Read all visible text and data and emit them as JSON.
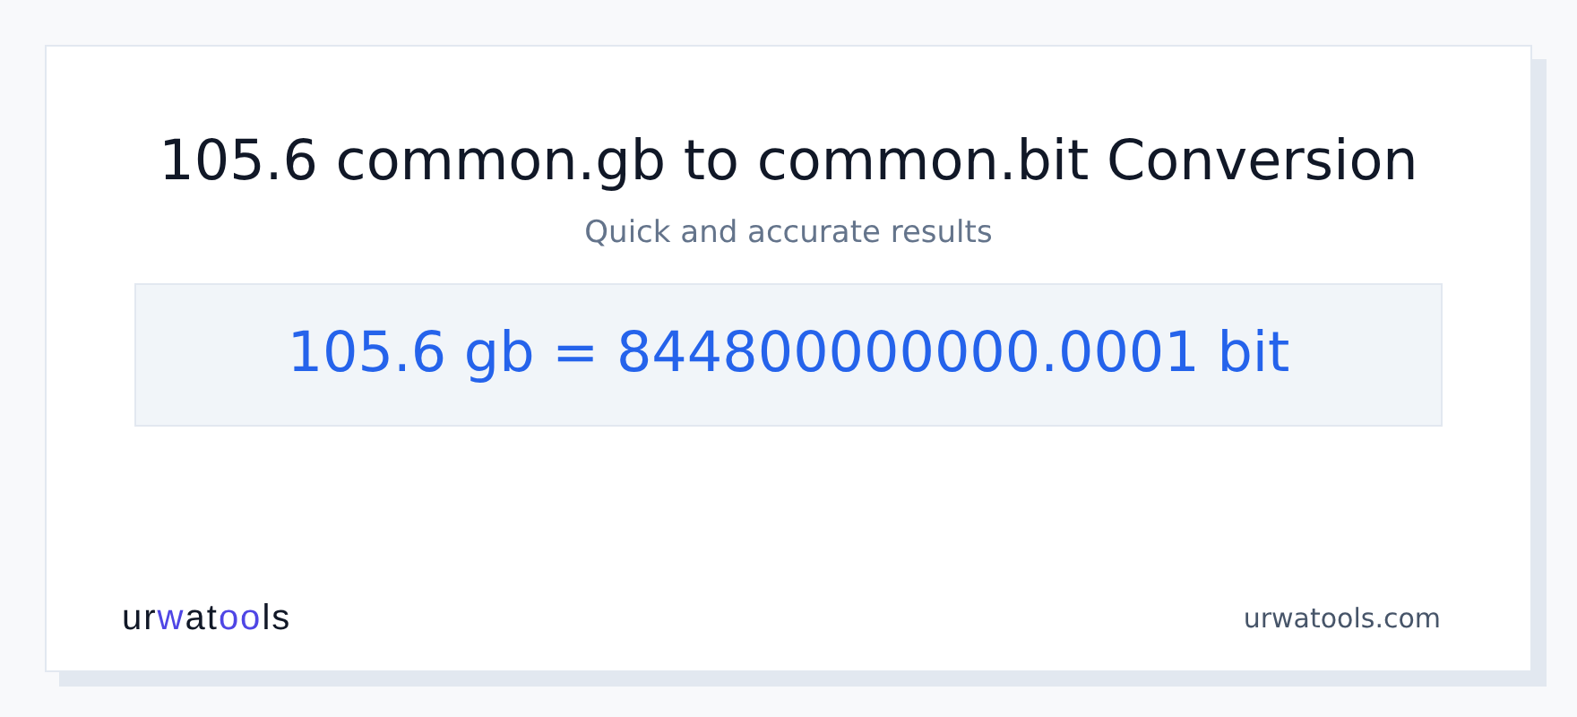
{
  "title": "105.6 common.gb to common.bit Conversion",
  "subtitle": "Quick and accurate results",
  "result": "105.6 gb = 844800000000.0001 bit",
  "logo": {
    "parts": [
      {
        "text": "ur",
        "accent": false
      },
      {
        "text": "w",
        "accent": true
      },
      {
        "text": "at",
        "accent": false
      },
      {
        "text": "oo",
        "accent": true
      },
      {
        "text": "ls",
        "accent": false
      }
    ]
  },
  "site": "urwatools.com"
}
